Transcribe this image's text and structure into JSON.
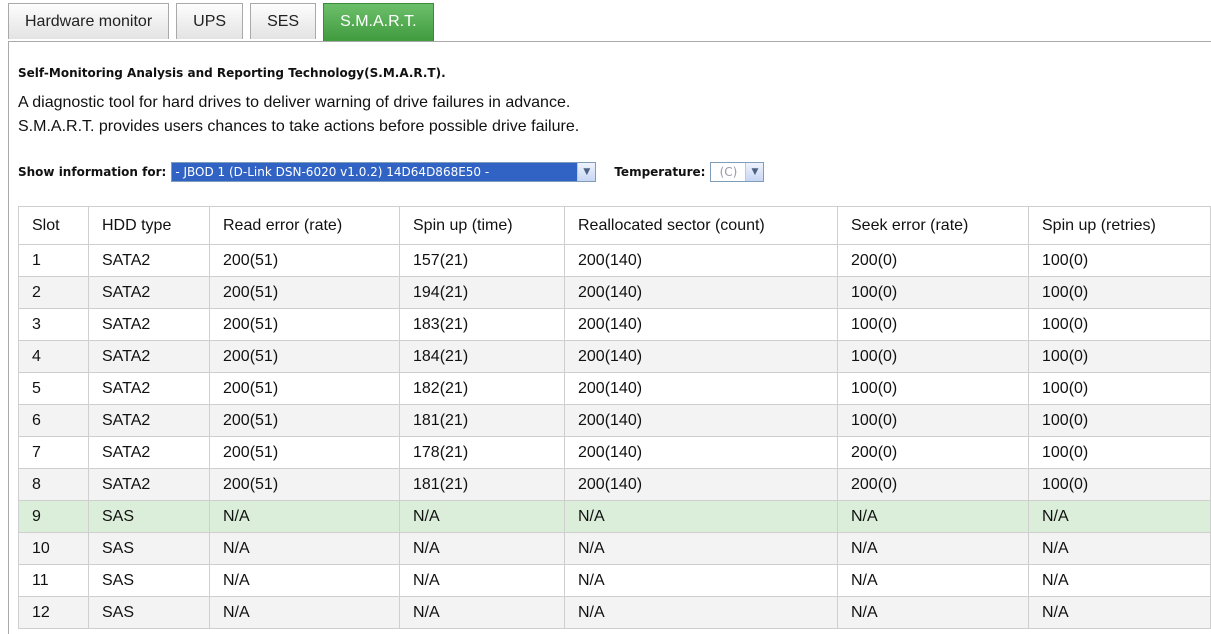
{
  "tabs": [
    {
      "label": "Hardware monitor",
      "active": false
    },
    {
      "label": "UPS",
      "active": false
    },
    {
      "label": "SES",
      "active": false
    },
    {
      "label": "S.M.A.R.T.",
      "active": true
    }
  ],
  "heading": "Self-Monitoring Analysis and Reporting Technology(S.M.A.R.T).",
  "description": [
    "A diagnostic tool for hard drives to deliver warning of drive failures in advance.",
    "S.M.A.R.T. provides users chances to take actions before possible drive failure."
  ],
  "filters": {
    "show_label": "Show information for:",
    "show_value": "- JBOD 1 (D-Link DSN-6020 v1.0.2) 14D64D868E50 -",
    "temp_label": "Temperature:",
    "temp_value": "(C)"
  },
  "table": {
    "columns": [
      "Slot",
      "HDD type",
      "Read error (rate)",
      "Spin up (time)",
      "Reallocated sector (count)",
      "Seek error (rate)",
      "Spin up (retries)"
    ],
    "highlighted_slot": "9",
    "rows": [
      [
        "1",
        "SATA2",
        "200(51)",
        "157(21)",
        "200(140)",
        "200(0)",
        "100(0)"
      ],
      [
        "2",
        "SATA2",
        "200(51)",
        "194(21)",
        "200(140)",
        "100(0)",
        "100(0)"
      ],
      [
        "3",
        "SATA2",
        "200(51)",
        "183(21)",
        "200(140)",
        "100(0)",
        "100(0)"
      ],
      [
        "4",
        "SATA2",
        "200(51)",
        "184(21)",
        "200(140)",
        "100(0)",
        "100(0)"
      ],
      [
        "5",
        "SATA2",
        "200(51)",
        "182(21)",
        "200(140)",
        "100(0)",
        "100(0)"
      ],
      [
        "6",
        "SATA2",
        "200(51)",
        "181(21)",
        "200(140)",
        "100(0)",
        "100(0)"
      ],
      [
        "7",
        "SATA2",
        "200(51)",
        "178(21)",
        "200(140)",
        "200(0)",
        "100(0)"
      ],
      [
        "8",
        "SATA2",
        "200(51)",
        "181(21)",
        "200(140)",
        "200(0)",
        "100(0)"
      ],
      [
        "9",
        "SAS",
        "N/A",
        "N/A",
        "N/A",
        "N/A",
        "N/A"
      ],
      [
        "10",
        "SAS",
        "N/A",
        "N/A",
        "N/A",
        "N/A",
        "N/A"
      ],
      [
        "11",
        "SAS",
        "N/A",
        "N/A",
        "N/A",
        "N/A",
        "N/A"
      ],
      [
        "12",
        "SAS",
        "N/A",
        "N/A",
        "N/A",
        "N/A",
        "N/A"
      ]
    ]
  },
  "icons": {
    "dropdown_arrow": "chevron-down-icon"
  },
  "colors": {
    "active_tab": "#4caa4a",
    "selected_option": "#3163c5",
    "highlight_row": "#dbeeda"
  }
}
